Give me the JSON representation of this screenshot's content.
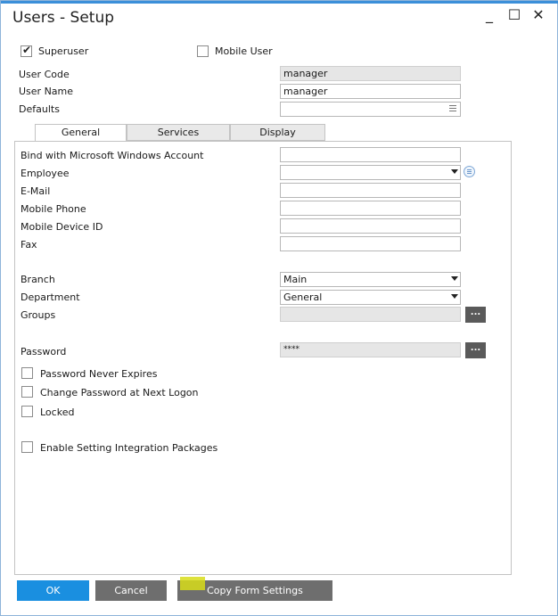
{
  "window": {
    "title": "Users - Setup",
    "minimize": "_",
    "maximize": "☐",
    "close": "✕"
  },
  "header": {
    "superuser_label": "Superuser",
    "superuser_checked": true,
    "mobile_user_label": "Mobile User",
    "mobile_user_checked": false,
    "user_code_label": "User Code",
    "user_code_value": "manager",
    "user_name_label": "User Name",
    "user_name_value": "manager",
    "defaults_label": "Defaults",
    "defaults_value": ""
  },
  "tabs": [
    {
      "label": "General",
      "active": true
    },
    {
      "label": "Services",
      "active": false
    },
    {
      "label": "Display",
      "active": false
    }
  ],
  "general": {
    "bind_label": "Bind with Microsoft Windows Account",
    "bind_value": "",
    "employee_label": "Employee",
    "employee_value": "",
    "email_label": "E-Mail",
    "email_value": "",
    "mobile_phone_label": "Mobile Phone",
    "mobile_phone_value": "",
    "mobile_device_label": "Mobile Device ID",
    "mobile_device_value": "",
    "fax_label": "Fax",
    "fax_value": "",
    "branch_label": "Branch",
    "branch_value": "Main",
    "department_label": "Department",
    "department_value": "General",
    "groups_label": "Groups",
    "groups_value": "",
    "password_label": "Password",
    "password_value": "****",
    "ellipsis": "...",
    "checkboxes": [
      {
        "label": "Password Never Expires",
        "checked": false
      },
      {
        "label": "Change Password at Next Logon",
        "checked": false
      },
      {
        "label": "Locked",
        "checked": false
      },
      {
        "label": "Enable Setting Integration Packages",
        "checked": false
      }
    ]
  },
  "footer": {
    "ok_label": "OK",
    "cancel_label": "Cancel",
    "copy_label": "Copy Form Settings"
  },
  "colors": {
    "ok_button": "#1a8fe0",
    "gray_button": "#6e6e6e",
    "highlight": "#d8dd1a"
  }
}
